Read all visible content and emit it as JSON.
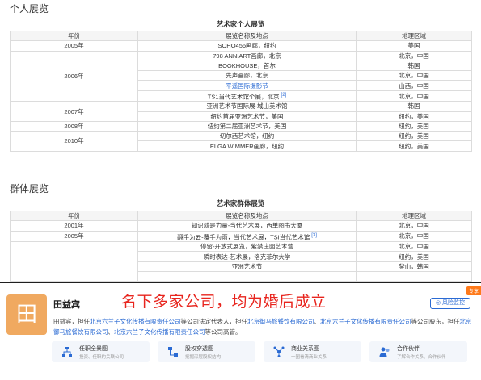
{
  "solo": {
    "section_title": "个人展览",
    "caption": "艺术家个人展览",
    "headers": [
      "年份",
      "展览名称及地点",
      "地理区域"
    ],
    "rows": [
      {
        "year": "2005年",
        "span": 1,
        "name": "SOHO456画廊，纽约",
        "region": "美国"
      },
      {
        "year": "2006年",
        "span": 5,
        "name": "798 ANNIART画廊，北京",
        "region": "北京，中国"
      },
      {
        "name": "BOOKHOUSE，首尔",
        "region": "韩国"
      },
      {
        "name": "先声画廊，北京",
        "region": "北京，中国"
      },
      {
        "name": "平遥国际摄影节",
        "region": "山西，中国",
        "link": true
      },
      {
        "name": "TS1当代艺术馆个展，北京",
        "region": "北京，中国",
        "ref": "[2]"
      },
      {
        "year": "2007年",
        "span": 2,
        "name": "亚洲艺术节国际展-城山美术馆",
        "region": "韩国"
      },
      {
        "name": "纽约首届亚洲艺术节，美国",
        "region": "纽约，美国"
      },
      {
        "year": "2008年",
        "span": 1,
        "name": "纽约第二届亚洲艺术节，美国",
        "region": "纽约，美国"
      },
      {
        "year": "2010年",
        "span": 2,
        "name": "切尔西艺术馆，纽约",
        "region": "纽约，美国"
      },
      {
        "name": "ELGA WIMMER画廊，纽约",
        "region": "纽约，美国"
      }
    ]
  },
  "group": {
    "section_title": "群体展览",
    "caption": "艺术家群体展览",
    "headers": [
      "年份",
      "展览名称及地点",
      "地理区域"
    ],
    "rows": [
      {
        "year": "2001年",
        "span": 1,
        "name": "知识就是力量-当代艺术展，西单图书大厦",
        "region": "北京，中国"
      },
      {
        "year": "2005年",
        "span": 1,
        "name": "翻手为云-覆手为雨，当代艺术展，TSI当代艺术馆",
        "region": "北京，中国",
        "ref": "[3]"
      },
      {
        "year": "",
        "span": 4,
        "name": "停留-开放式展览，紫禁庄园艺术营",
        "region": "北京，中国"
      },
      {
        "name": "瞬时表达-艺术展，洛克菲尔大学",
        "region": "纽约，美国"
      },
      {
        "name": "亚洲艺术节",
        "region": "釜山，韩国"
      },
      {
        "name": "",
        "region": ""
      }
    ]
  },
  "company": {
    "avatar_char": "田",
    "name": "田益宾",
    "headline": "名下多家公司，均为婚后成立",
    "tag": "专享",
    "risk_button": "风险监控",
    "desc_parts": [
      {
        "text": "田益宾，担任",
        "link": false
      },
      {
        "text": "北京六兰子文化传播有限责任公司",
        "link": true
      },
      {
        "text": "等公司法定代表人，担任",
        "link": false
      },
      {
        "text": "北京御马旅餐饮有限公司",
        "link": true
      },
      {
        "text": "、",
        "link": false
      },
      {
        "text": "北京六兰子文化传播有限责任公司",
        "link": true
      },
      {
        "text": "等公司股东，担任",
        "link": false
      },
      {
        "text": "北京御马旅餐饮有限公司",
        "link": true
      },
      {
        "text": "、",
        "link": false
      },
      {
        "text": "北京六兰子文化传播有限责任公司",
        "link": true
      },
      {
        "text": "等公司高管。",
        "link": false
      }
    ],
    "cards": [
      {
        "title": "任职全景图",
        "sub": "投资、任职的关联公司",
        "icon": "org-chart-icon"
      },
      {
        "title": "股权穿透图",
        "sub": "挖掘深层股权结构",
        "icon": "equity-chart-icon"
      },
      {
        "title": "商业关系图",
        "sub": "一图看清商业关系",
        "icon": "relation-chart-icon"
      },
      {
        "title": "合作伙伴",
        "sub": "了解合作关系、合作伙伴",
        "icon": "partners-icon"
      }
    ],
    "colors": {
      "avatar": "#f0a960",
      "headline": "#e8251e",
      "link": "#2a6ad3",
      "tag": "#ff7a1a"
    }
  }
}
